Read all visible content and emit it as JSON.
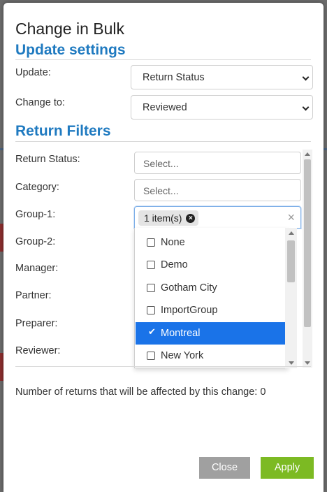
{
  "dialog": {
    "title": "Change in Bulk"
  },
  "update_settings": {
    "heading": "Update settings",
    "update_label": "Update:",
    "update_value": "Return Status",
    "change_to_label": "Change to:",
    "change_to_value": "Reviewed"
  },
  "return_filters": {
    "heading": "Return Filters",
    "return_status_label": "Return Status:",
    "return_status_placeholder": "Select...",
    "category_label": "Category:",
    "category_placeholder": "Select...",
    "group1_label": "Group-1:",
    "group1_chip": "1 item(s)",
    "group2_label": "Group-2:",
    "manager_label": "Manager:",
    "partner_label": "Partner:",
    "preparer_label": "Preparer:",
    "reviewer_label": "Reviewer:"
  },
  "group1_options": [
    {
      "label": "None",
      "checked": false
    },
    {
      "label": "Demo",
      "checked": false
    },
    {
      "label": "Gotham City",
      "checked": false
    },
    {
      "label": "ImportGroup",
      "checked": false
    },
    {
      "label": "Montreal",
      "checked": true
    },
    {
      "label": "New York",
      "checked": false
    }
  ],
  "summary": {
    "affected_text": "Number of returns that will be affected by this change: 0"
  },
  "buttons": {
    "close": "Close",
    "apply": "Apply"
  },
  "colors": {
    "heading": "#1f7ac0",
    "selected_option": "#1a73e8",
    "apply_button": "#7cba23",
    "close_button": "#a0a0a0"
  },
  "icons": {
    "chip_remove": "circle-x-icon",
    "clear_selection": "close-icon",
    "select_chevron": "chevron-down-icon"
  }
}
